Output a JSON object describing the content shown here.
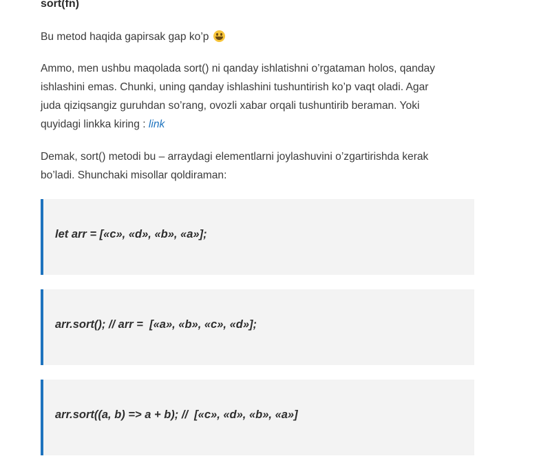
{
  "heading": "sort(fn)",
  "paragraphs": {
    "p1": "Bu metod haqida gapirsak gap ko’p",
    "p2_line1": "Ammo, men ushbu maqolada sort() ni qanday ishlatishni o’rgataman holos, qanday",
    "p2_line2": "ishlashini emas. Chunki, uning qanday ishlashini tushuntirish ko’p vaqt oladi. Agar",
    "p2_line3": "juda qiziqsangiz guruhdan so’rang, ovozli xabar orqali tushuntirib beraman. Yoki",
    "p2_line4": "quyidagi linkka kiring : ",
    "p2_link": "link",
    "p3_line1": "Demak, sort() metodi bu – arraydagi elementlarni joylashuvini o’zgartirishda kerak",
    "p3_line2": "bo’ladi. Shunchaki misollar qoldiraman:"
  },
  "emoji_icon": "grinning-face-icon",
  "accent_color": "#1e73be",
  "quotes": [
    "let arr = [«c», «d», «b», «a»];",
    "arr.sort(); // arr =  [«a», «b», «c», «d»];",
    "arr.sort((a, b) => a + b); //  [«c», «d», «b», «a»]"
  ]
}
